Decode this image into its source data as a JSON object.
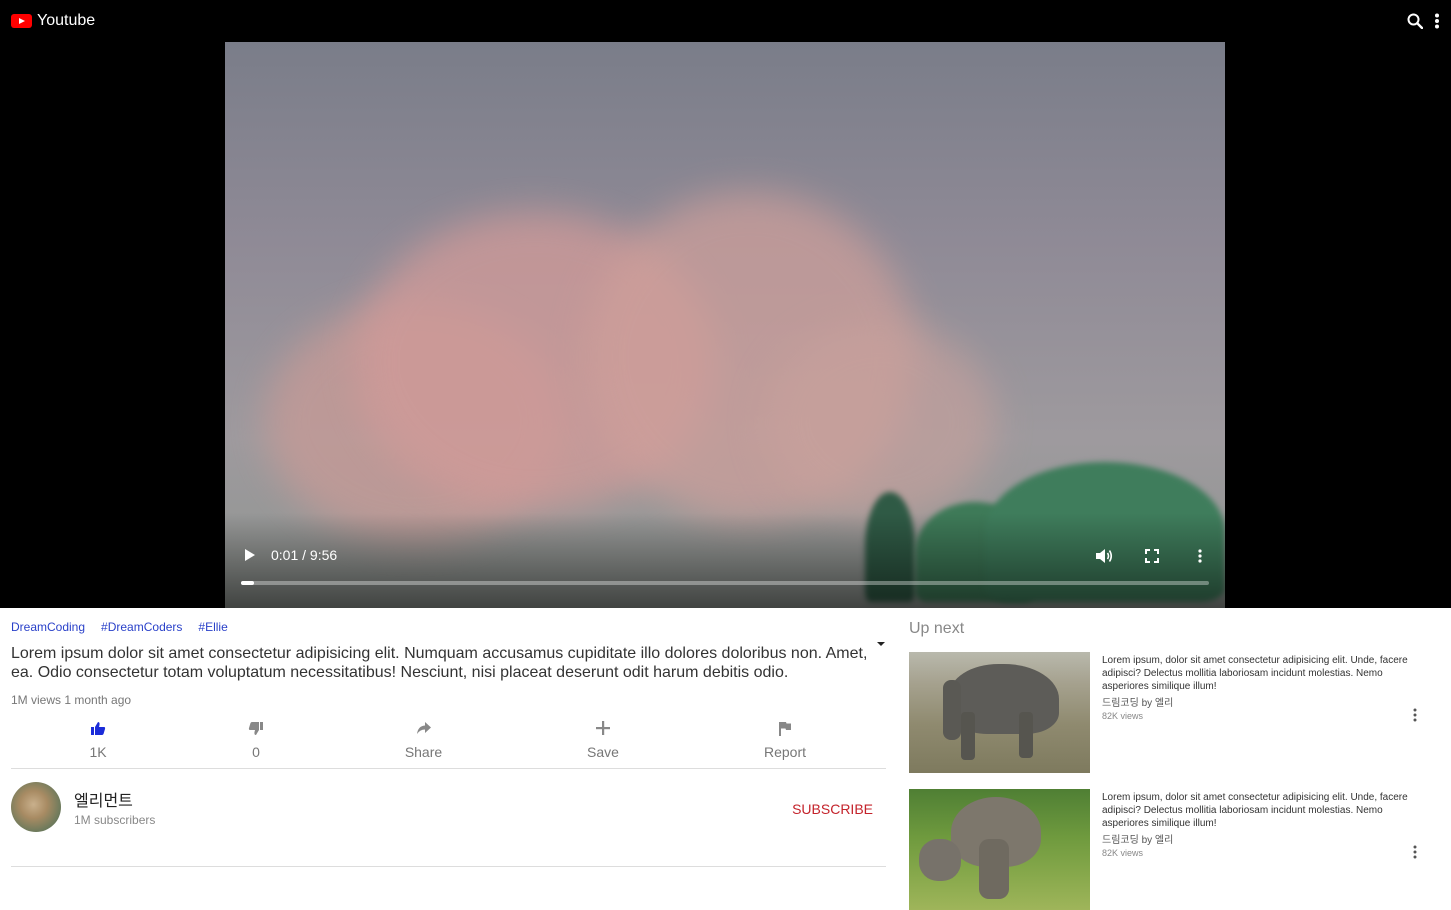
{
  "header": {
    "title": "Youtube"
  },
  "player": {
    "time_display": "0:01 / 9:56",
    "progress_fraction": 0.013
  },
  "info": {
    "tags": [
      "DreamCoding",
      "#DreamCoders",
      "#Ellie"
    ],
    "title": "Lorem ipsum dolor sit amet consectetur adipisicing elit. Numquam accusamus cupiditate illo dolores doloribus non. Amet, ea. Odio consectetur totam voluptatum necessitatibus! Nesciunt, nisi placeat deserunt odit harum debitis odio.",
    "meta": "1M views 1 month ago",
    "actions": [
      {
        "label": "1K",
        "icon": "thumbs-up-icon"
      },
      {
        "label": "0",
        "icon": "thumbs-down-icon"
      },
      {
        "label": "Share",
        "icon": "share-icon"
      },
      {
        "label": "Save",
        "icon": "plus-icon"
      },
      {
        "label": "Report",
        "icon": "flag-icon"
      }
    ]
  },
  "channel": {
    "name": "엘리먼트",
    "subscribers": "1M subscribers",
    "subscribe_label": "SUBSCRIBE"
  },
  "upnext": {
    "title": "Up next",
    "items": [
      {
        "description": "Lorem ipsum, dolor sit amet consectetur adipisicing elit. Unde, facere adipisci? Delectus mollitia laboriosam incidunt molestias. Nemo asperiores similique illum!",
        "channel": "드림코딩 by 엘리",
        "views": "82K views"
      },
      {
        "description": "Lorem ipsum, dolor sit amet consectetur adipisicing elit. Unde, facere adipisci? Delectus mollitia laboriosam incidunt molestias. Nemo asperiores similique illum!",
        "channel": "드림코딩 by 엘리",
        "views": "82K views"
      }
    ]
  },
  "colors": {
    "brand_red": "#ff0000",
    "tag_blue": "#2a41c9",
    "like_blue": "#1a2bd9",
    "subscribe_red": "#c4232b"
  }
}
